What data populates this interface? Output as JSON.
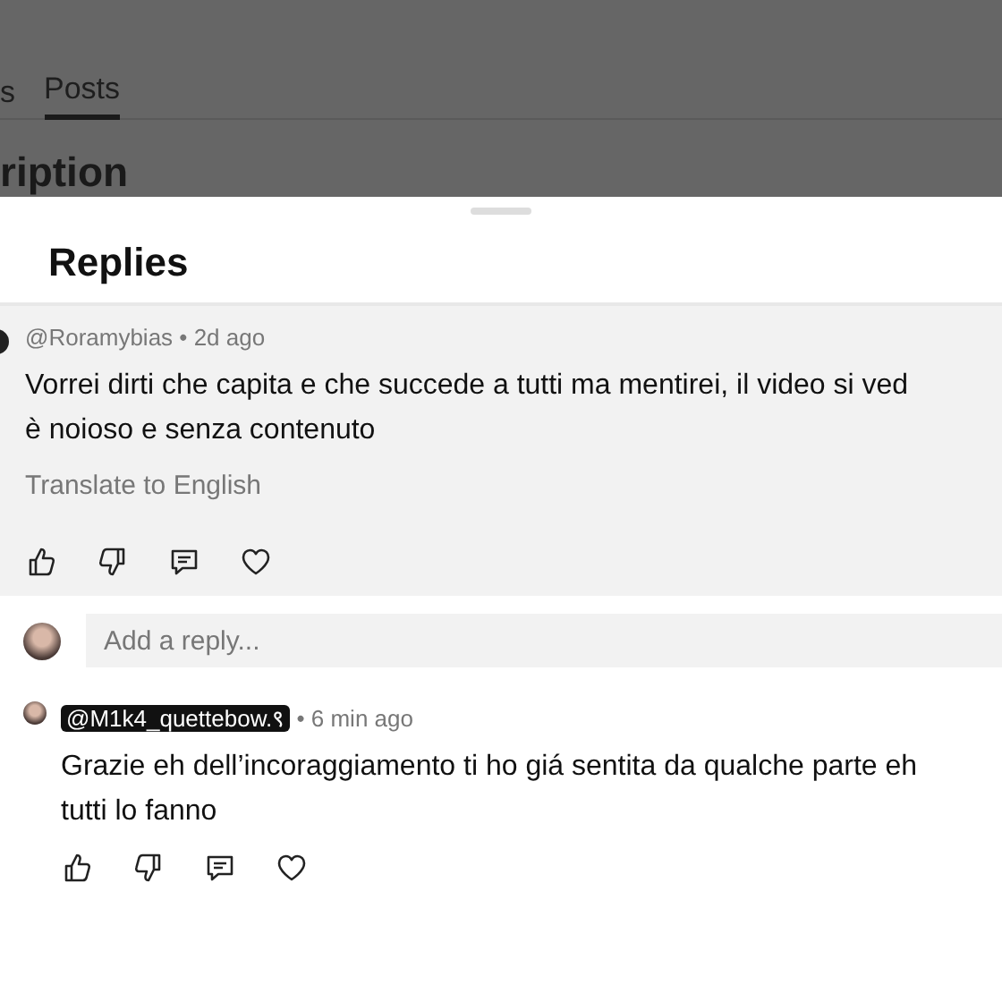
{
  "background": {
    "tabs": [
      {
        "label": "s",
        "selected": false
      },
      {
        "label": "Posts",
        "selected": true
      }
    ],
    "heading": "ription"
  },
  "sheet": {
    "title": "Replies",
    "comment": {
      "author": "@Roramybias",
      "separator": "•",
      "time": "2d ago",
      "lines": [
        "Vorrei dirti che capita e che succede a tutti ma mentirei, il video si ved",
        "è noioso e senza contenuto"
      ],
      "translate": "Translate to English"
    },
    "reply_field": {
      "placeholder": "Add a reply..."
    },
    "replies": [
      {
        "author": "@M1k4_quettebow.९",
        "time": "6 min ago",
        "highlighted": true,
        "separator": "•",
        "lines": [
          "Grazie eh dell’incoraggiamento ti ho giá sentita da qualche parte eh",
          "tutti lo fanno"
        ]
      }
    ]
  }
}
